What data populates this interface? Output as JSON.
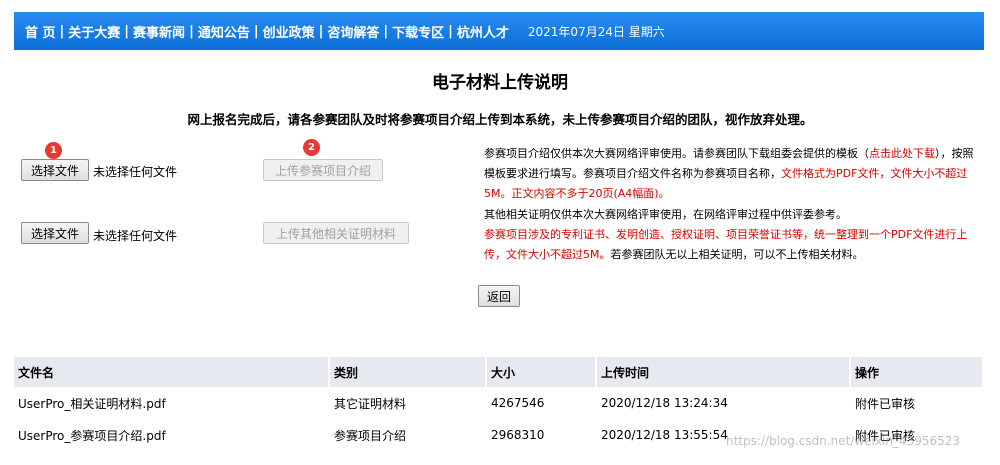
{
  "nav": {
    "items": [
      "首 页",
      "关于大赛",
      "赛事新闻",
      "通知公告",
      "创业政策",
      "咨询解答",
      "下载专区",
      "杭州人才"
    ],
    "date": "2021年07月24日 星期六"
  },
  "page": {
    "title": "电子材料上传说明",
    "notice": "网上报名完成后，请各参赛团队及时将参赛项目介绍上传到本系统，未上传参赛项目介绍的团队，视作放弃处理。"
  },
  "upload1": {
    "choose_label": "选择文件",
    "no_file": "未选择任何文件",
    "upload_label": "上传参赛项目介绍",
    "desc_a": "参赛项目介绍仅供本次大赛网络评审使用。请参赛团队下载组委会提供的模板（",
    "desc_link": "点击此处下载",
    "desc_b": "），按照模板要求进行填写。参赛项目介绍文件名称为参赛项目名称，",
    "desc_red": "文件格式为PDF文件，文件大小不超过5M。正文内容不多于20页(A4幅面)。"
  },
  "upload2": {
    "choose_label": "选择文件",
    "no_file": "未选择任何文件",
    "upload_label": "上传其他相关证明材料",
    "desc_a": "其他相关证明仅供本次大赛网络评审使用，在网络评审过程中供评委参考。",
    "desc_red": "参赛项目涉及的专利证书、发明创造、授权证明、项目荣誉证书等，统一整理到一个PDF文件进行上传，文件大小不超过5M。",
    "desc_b": "若参赛团队无以上相关证明，可以不上传相关材料。"
  },
  "badges": [
    "1",
    "2"
  ],
  "back_label": "返回",
  "table": {
    "headers": [
      "文件名",
      "类别",
      "大小",
      "上传时间",
      "操作"
    ],
    "rows": [
      [
        "UserPro_相关证明材料.pdf",
        "其它证明材料",
        "4267546",
        "2020/12/18 13:24:34",
        "附件已审核"
      ],
      [
        "UserPro_参赛项目介绍.pdf",
        "参赛项目介绍",
        "2968310",
        "2020/12/18 13:55:54",
        "附件已审核"
      ]
    ]
  },
  "watermark": "https://blog.csdn.net/weixin_43956523",
  "colors": {
    "nav_bg": "#1a7fe6",
    "table_header": "#e6e9ef",
    "accent_red": "#d40000",
    "badge": "#e53935"
  }
}
